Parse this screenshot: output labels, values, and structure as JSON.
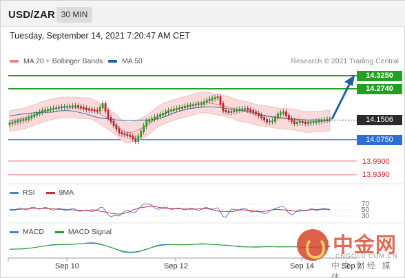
{
  "header": {
    "symbol": "USD/ZAR",
    "timeframe": "30 MIN"
  },
  "datetime": "Tuesday, September 14, 2021 7:20:47 AM CET",
  "legend": {
    "items": [
      {
        "label": "MA 20 + Bollinger Bands",
        "color": "#f08080"
      },
      {
        "label": "MA 50",
        "color": "#1f5fa8"
      }
    ],
    "credit": "Research © 2021 Trading Central"
  },
  "levels": [
    {
      "value": "14.3250",
      "type": "resistance",
      "color": "#22a022"
    },
    {
      "value": "14.2740",
      "type": "resistance",
      "color": "#22a022"
    },
    {
      "value": "14.1506",
      "type": "last",
      "color": "#2a2a2a"
    },
    {
      "value": "14.0750",
      "type": "pivot",
      "color": "#2b6fd6"
    },
    {
      "value": "13.9900",
      "type": "support",
      "color": "#d92a2a"
    },
    {
      "value": "13.9390",
      "type": "support",
      "color": "#d92a2a"
    }
  ],
  "rsi": {
    "legend": [
      {
        "label": "RSI",
        "color": "#4a7fd6"
      },
      {
        "label": "9MA",
        "color": "#d62a2a"
      }
    ],
    "ticks": [
      "70",
      "50",
      "30"
    ]
  },
  "macd": {
    "legend": [
      {
        "label": "MACD",
        "color": "#4a7fd6"
      },
      {
        "label": "MACD Signal",
        "color": "#22a022"
      }
    ]
  },
  "xaxis": {
    "labels": [
      "Sep 10",
      "Sep 12",
      "Sep 14",
      "Sep 2"
    ]
  },
  "watermark": {
    "brand_cn": "中金网",
    "url": "CNGOLD.COM.CN",
    "sub_cn": "中文 财经 媒 体"
  },
  "colors": {
    "up_candle": "#22a022",
    "down_candle": "#cc2222",
    "band_fill": "#fbdada",
    "arrow": "#1f5fa8"
  }
}
